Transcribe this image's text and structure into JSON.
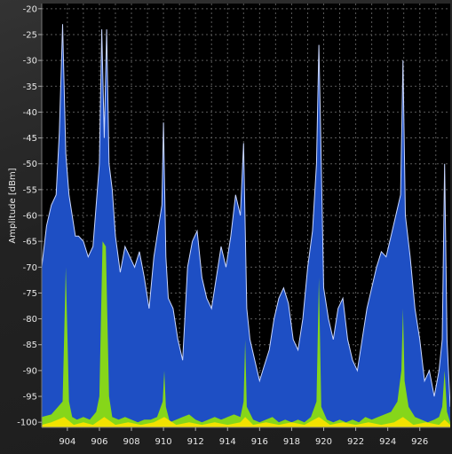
{
  "chart_data": {
    "type": "area",
    "title": "",
    "xlabel": "",
    "ylabel": "Amplitude [dBm]",
    "xlim": [
      902.4,
      927.9
    ],
    "ylim": [
      -101,
      -19
    ],
    "x_ticks": [
      "904",
      "906",
      "908",
      "910",
      "912",
      "914",
      "916",
      "918",
      "920",
      "922",
      "924",
      "926"
    ],
    "y_ticks": [
      "-20",
      "-25",
      "-30",
      "-35",
      "-40",
      "-45",
      "-50",
      "-55",
      "-60",
      "-65",
      "-70",
      "-75",
      "-80",
      "-85",
      "-90",
      "-95",
      "-100"
    ],
    "grid": true,
    "colors": {
      "plot_background": "#000000",
      "grid": "#5a5a5a",
      "max_hold": "#1e4fc4",
      "max_hold_outline": "#c8d6ff",
      "average": "#86d61a",
      "current": "#f2e200"
    },
    "series": [
      {
        "role": "max_hold",
        "x": [
          902.4,
          902.7,
          903.0,
          903.3,
          903.5,
          903.7,
          903.9,
          904.1,
          904.3,
          904.5,
          904.7,
          905.0,
          905.3,
          905.6,
          905.8,
          906.0,
          906.15,
          906.3,
          906.45,
          906.6,
          906.8,
          907.0,
          907.3,
          907.6,
          907.9,
          908.2,
          908.5,
          908.8,
          909.1,
          909.4,
          909.7,
          909.9,
          910.0,
          910.15,
          910.3,
          910.6,
          910.9,
          911.2,
          911.5,
          911.8,
          912.1,
          912.4,
          912.7,
          913.0,
          913.3,
          913.6,
          913.9,
          914.2,
          914.5,
          914.8,
          915.0,
          915.1,
          915.2,
          915.4,
          915.7,
          916.0,
          916.3,
          916.6,
          916.9,
          917.2,
          917.5,
          917.8,
          918.1,
          918.4,
          918.7,
          919.0,
          919.3,
          919.55,
          919.7,
          919.85,
          920.0,
          920.3,
          920.6,
          920.9,
          921.2,
          921.5,
          921.8,
          922.1,
          922.4,
          922.7,
          923.0,
          923.3,
          923.6,
          923.9,
          924.2,
          924.5,
          924.8,
          924.95,
          925.1,
          925.4,
          925.7,
          926.0,
          926.3,
          926.6,
          926.9,
          927.2,
          927.4,
          927.55,
          927.7,
          927.9
        ],
        "values": [
          -70,
          -62,
          -58,
          -56,
          -44,
          -23,
          -48,
          -56,
          -60,
          -64,
          -64,
          -65,
          -68,
          -66,
          -58,
          -50,
          -24,
          -45,
          -24,
          -50,
          -55,
          -64,
          -71,
          -66,
          -68,
          -70,
          -67,
          -72,
          -78,
          -68,
          -62,
          -58,
          -42,
          -68,
          -76,
          -78,
          -84,
          -88,
          -70,
          -65,
          -63,
          -72,
          -76,
          -78,
          -72,
          -66,
          -70,
          -64,
          -56,
          -60,
          -46,
          -62,
          -78,
          -84,
          -88,
          -92,
          -89,
          -86,
          -80,
          -76,
          -74,
          -77,
          -84,
          -86,
          -80,
          -70,
          -63,
          -50,
          -27,
          -50,
          -74,
          -80,
          -84,
          -78,
          -76,
          -84,
          -88,
          -90,
          -84,
          -78,
          -74,
          -70,
          -67,
          -68,
          -64,
          -60,
          -56,
          -30,
          -60,
          -68,
          -78,
          -84,
          -92,
          -90,
          -95,
          -90,
          -84,
          -50,
          -84,
          -97
        ]
      },
      {
        "role": "average",
        "x": [
          902.4,
          903.0,
          903.7,
          903.9,
          904.1,
          904.3,
          904.6,
          905.0,
          905.4,
          905.8,
          906.0,
          906.2,
          906.4,
          906.6,
          906.8,
          907.2,
          907.6,
          908.0,
          908.4,
          908.8,
          909.2,
          909.6,
          909.95,
          910.05,
          910.15,
          910.4,
          910.8,
          911.2,
          911.6,
          912.0,
          912.4,
          912.8,
          913.2,
          913.6,
          914.0,
          914.4,
          914.8,
          915.0,
          915.1,
          915.2,
          915.6,
          916.0,
          916.4,
          916.8,
          917.2,
          917.6,
          918.0,
          918.4,
          918.8,
          919.2,
          919.55,
          919.7,
          919.85,
          920.2,
          920.6,
          921.0,
          921.4,
          921.8,
          922.2,
          922.6,
          923.0,
          923.4,
          923.8,
          924.2,
          924.6,
          924.85,
          924.95,
          925.05,
          925.3,
          925.7,
          926.1,
          926.5,
          926.9,
          927.2,
          927.4,
          927.55,
          927.7,
          927.9
        ],
        "values": [
          -99,
          -98.5,
          -96,
          -70,
          -96,
          -99,
          -99.5,
          -99,
          -99.5,
          -98,
          -95,
          -65,
          -66,
          -95,
          -99,
          -99.5,
          -99,
          -99.5,
          -100,
          -99.5,
          -99.5,
          -99,
          -96,
          -90,
          -97,
          -100,
          -99.5,
          -99,
          -98.5,
          -99.5,
          -100,
          -99.5,
          -99,
          -99.5,
          -99,
          -98.5,
          -99,
          -96,
          -84,
          -97,
          -99.5,
          -100,
          -99.5,
          -99,
          -100,
          -99.5,
          -100,
          -99.5,
          -100,
          -99,
          -96,
          -72,
          -97,
          -99.5,
          -100,
          -99.5,
          -100,
          -99.5,
          -100,
          -99,
          -99.5,
          -99,
          -98.5,
          -98,
          -96,
          -90,
          -78,
          -92,
          -97,
          -99,
          -99.5,
          -100,
          -99.5,
          -99,
          -97,
          -90,
          -98,
          -100
        ]
      },
      {
        "role": "current",
        "x": [
          902.4,
          903.0,
          903.8,
          904.4,
          905.0,
          905.6,
          906.3,
          907.0,
          907.8,
          908.6,
          909.4,
          910.05,
          910.8,
          911.6,
          912.4,
          913.2,
          914.0,
          914.8,
          915.1,
          915.6,
          916.4,
          917.2,
          918.0,
          918.8,
          919.7,
          920.4,
          921.2,
          922.0,
          922.8,
          923.6,
          924.4,
          924.95,
          925.6,
          926.4,
          927.2,
          927.55,
          927.9
        ],
        "values": [
          -100.5,
          -100,
          -99,
          -100.5,
          -100,
          -100.5,
          -99,
          -100.5,
          -100,
          -100.5,
          -100,
          -99,
          -100.5,
          -100,
          -100.5,
          -100,
          -100.5,
          -100,
          -99,
          -100.5,
          -100,
          -100.5,
          -100,
          -100.5,
          -99,
          -100.5,
          -100,
          -100.5,
          -100,
          -100.5,
          -100,
          -99,
          -100.5,
          -100,
          -100.5,
          -99.5,
          -100.5
        ]
      }
    ]
  }
}
